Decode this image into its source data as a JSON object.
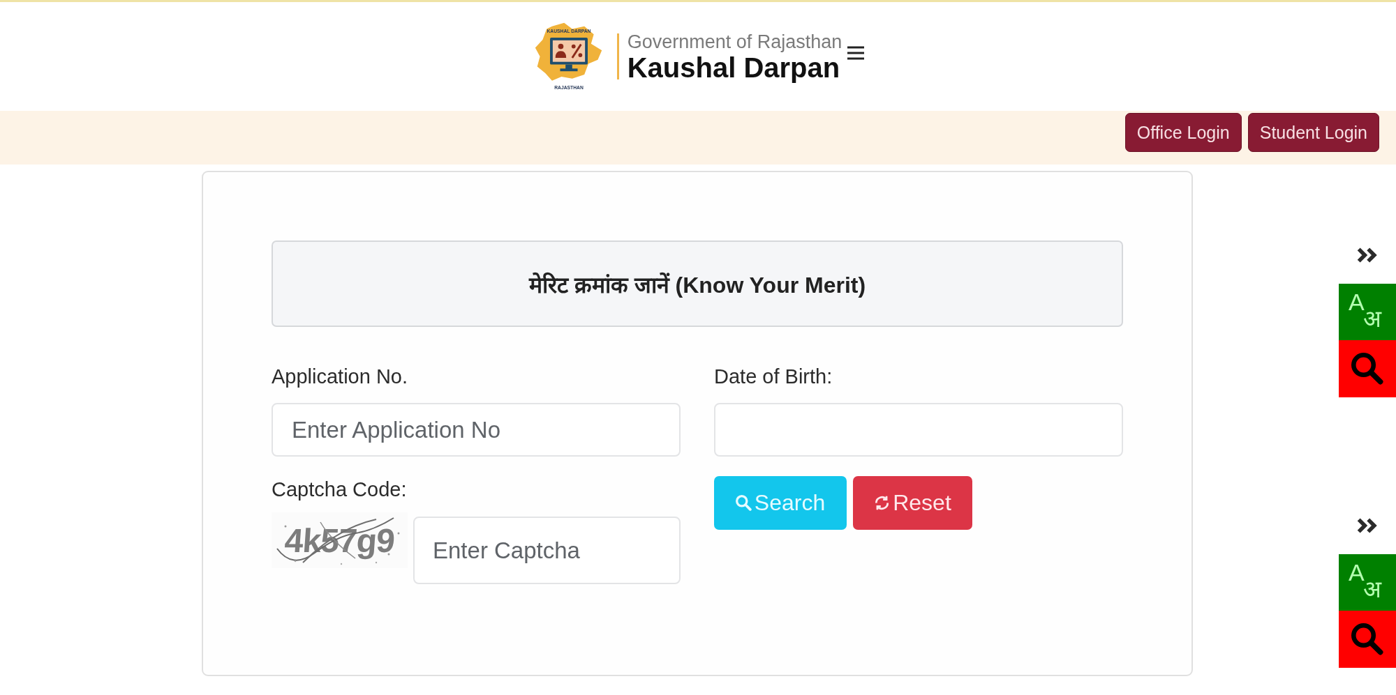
{
  "header": {
    "logo": {
      "top_text": "KAUSHAL DARPAN",
      "bottom_text": "RAJASTHAN"
    },
    "subtitle": "Government of Rajasthan",
    "title": "Kaushal Darpan"
  },
  "nav": {
    "buttons": [
      "Office Login",
      "Student Login"
    ]
  },
  "form": {
    "heading": "मेरिट क्रमांक जानें (Know Your Merit)",
    "application": {
      "label": "Application No.",
      "placeholder": "Enter Application No"
    },
    "date_of_birth": {
      "label": "Date of Birth:"
    },
    "captcha": {
      "label": "Captcha Code:",
      "image_text": "4k57g9",
      "placeholder": "Enter Captcha"
    },
    "buttons": [
      {
        "kind": "search",
        "label": "Search"
      },
      {
        "kind": "reset",
        "label": "Reset"
      }
    ]
  },
  "side_widgets": [
    {
      "latin": "A",
      "devanagari": "अ"
    },
    {
      "latin": "A",
      "devanagari": "अ"
    }
  ]
}
